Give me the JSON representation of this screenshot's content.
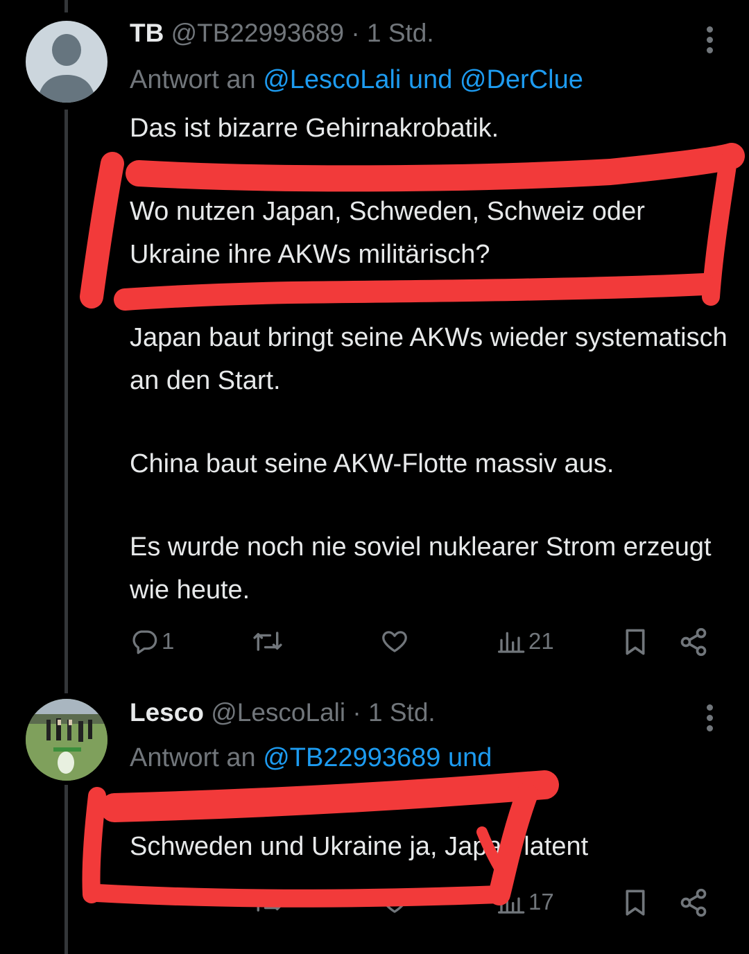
{
  "tweets": [
    {
      "display_name": "TB",
      "handle": "@TB22993689",
      "separator": "·",
      "time": "1 Std.",
      "reply_prefix": "Antwort an",
      "reply_to_1": "@LescoLali",
      "reply_joiner": "und",
      "reply_to_2": "@DerClue",
      "paragraphs": [
        "Das ist bizarre Gehirnakrobatik.",
        "Wo nutzen Japan, Schweden, Schweiz oder Ukraine ihre AKWs militärisch?",
        "Japan baut bringt seine AKWs wieder systematisch an den Start.",
        "China baut seine AKW-Flotte massiv aus.",
        "Es wurde noch nie soviel nuklearer Strom erzeugt wie heute."
      ],
      "actions": {
        "replies": "1",
        "views": "21"
      }
    },
    {
      "display_name": "Lesco",
      "handle": "@LescoLali",
      "separator": "·",
      "time": "1 Std.",
      "reply_prefix": "Antwort an",
      "reply_to_1": "@TB22993689 und",
      "paragraphs": [
        "Schweden und Ukraine ja, Japan latent"
      ],
      "actions": {
        "views": "17"
      }
    }
  ],
  "icons": {
    "reply": "reply-icon",
    "retweet": "retweet-icon",
    "like": "heart-icon",
    "views": "views-icon",
    "bookmark": "bookmark-icon",
    "share": "share-icon",
    "more": "more-icon"
  },
  "colors": {
    "background": "#000000",
    "text": "#e7e9ea",
    "muted": "#71767b",
    "link": "#1d9bf0",
    "annotation": "#f23a3a"
  }
}
